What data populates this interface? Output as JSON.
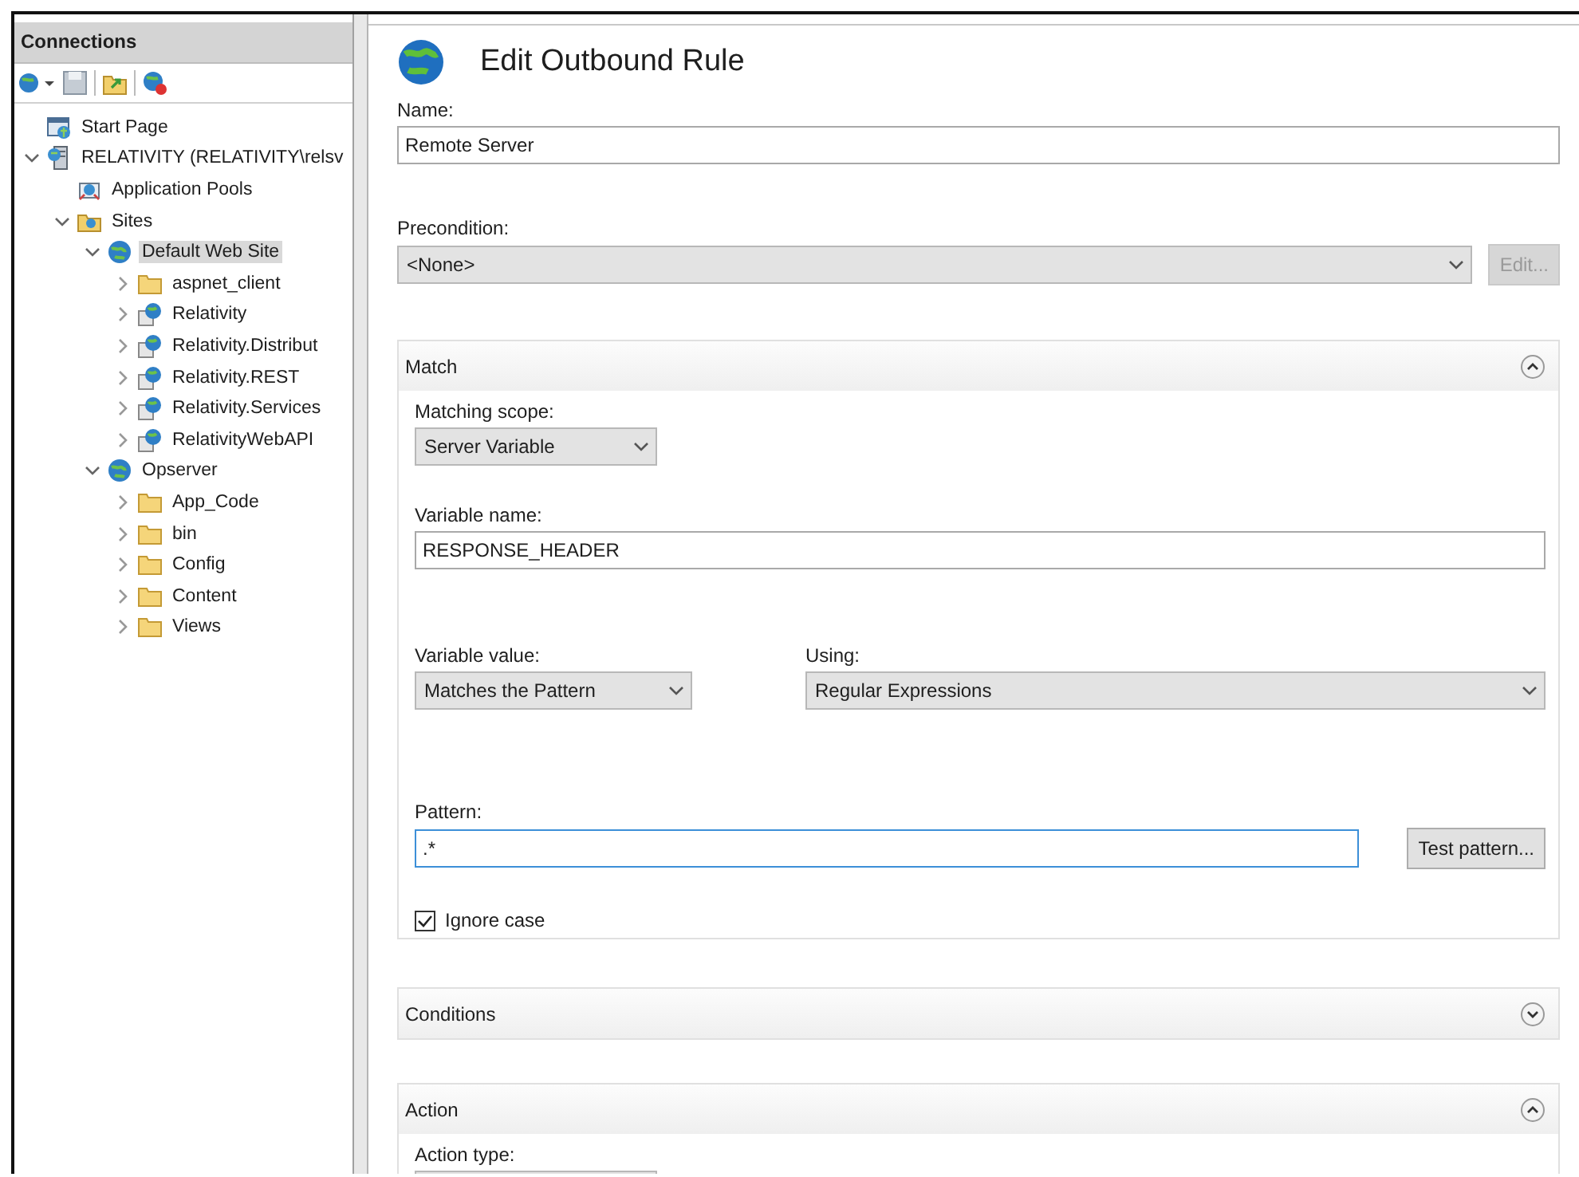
{
  "connections": {
    "title": "Connections"
  },
  "tree": [
    {
      "label": "Start Page",
      "kind": "page"
    },
    {
      "label": "RELATIVITY (RELATIVITY\\relsv",
      "kind": "server",
      "expanded": true,
      "children": [
        {
          "label": "Application Pools",
          "kind": "pools"
        },
        {
          "label": "Sites",
          "kind": "sites",
          "expanded": true,
          "children": [
            {
              "label": "Default Web Site",
              "kind": "site",
              "expanded": true,
              "selected": true,
              "children": [
                {
                  "label": "aspnet_client",
                  "kind": "folder",
                  "expanded": false,
                  "selected": false
                },
                {
                  "label": "Relativity",
                  "kind": "app",
                  "expanded": false,
                  "selected": false
                },
                {
                  "label": "Relativity.Distribut",
                  "kind": "app",
                  "expanded": false,
                  "selected": false
                },
                {
                  "label": "Relativity.REST",
                  "kind": "app",
                  "expanded": false,
                  "selected": false
                },
                {
                  "label": "Relativity.Services",
                  "kind": "app",
                  "expanded": false,
                  "selected": false
                },
                {
                  "label": "RelativityWebAPI",
                  "kind": "app",
                  "expanded": false,
                  "selected": false
                }
              ]
            },
            {
              "label": "Opserver",
              "kind": "site",
              "expanded": true,
              "selected": false,
              "children": [
                {
                  "label": "App_Code",
                  "kind": "folder",
                  "expanded": false,
                  "selected": false
                },
                {
                  "label": "bin",
                  "kind": "folder",
                  "expanded": false,
                  "selected": false
                },
                {
                  "label": "Config",
                  "kind": "folder",
                  "expanded": false,
                  "selected": false
                },
                {
                  "label": "Content",
                  "kind": "folder",
                  "expanded": false,
                  "selected": false
                },
                {
                  "label": "Views",
                  "kind": "folder",
                  "expanded": false,
                  "selected": false
                }
              ]
            }
          ]
        }
      ]
    }
  ],
  "editor": {
    "title": "Edit Outbound Rule",
    "name": {
      "label": "Name:",
      "value": "Remote Server"
    },
    "precondition": {
      "label": "Precondition:",
      "value": "<None>"
    },
    "edit_button": {
      "label": "Edit...",
      "disabled": true
    },
    "match": {
      "title": "Match",
      "expanded": true,
      "matching_scope": {
        "label": "Matching scope:",
        "value": "Server Variable"
      },
      "variable_name": {
        "label": "Variable name:",
        "value": "RESPONSE_HEADER"
      },
      "variable_value": {
        "label": "Variable value:",
        "value": "Matches the Pattern"
      },
      "using": {
        "label": "Using:",
        "value": "Regular Expressions"
      },
      "pattern": {
        "label": "Pattern:",
        "value": ".*",
        "focused": true
      },
      "test_button": {
        "label": "Test pattern..."
      },
      "ignore_case": {
        "label": "Ignore case",
        "checked": true
      }
    },
    "conditions": {
      "title": "Conditions",
      "expanded": false
    },
    "action": {
      "title": "Action",
      "expanded": true,
      "action_type": {
        "label": "Action type:"
      }
    }
  }
}
